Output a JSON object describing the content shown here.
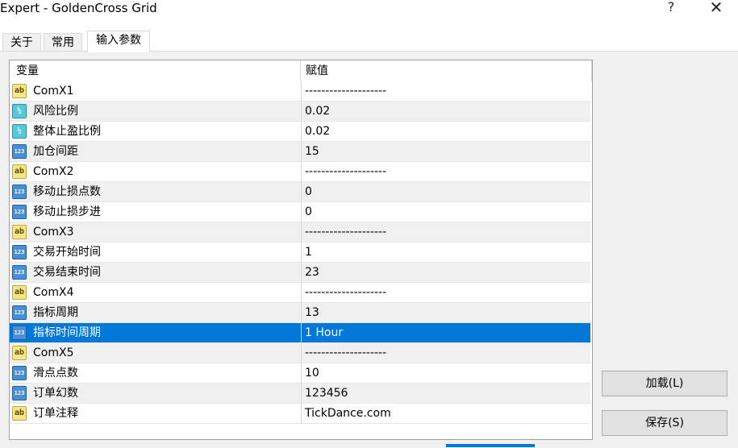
{
  "window": {
    "title": "Expert - GoldenCross Grid",
    "help_label": "?",
    "close_label": "✕"
  },
  "tabs": [
    {
      "label": "关于"
    },
    {
      "label": "常用"
    },
    {
      "label": "输入参数",
      "active": true
    }
  ],
  "grid": {
    "headers": {
      "name": "变量",
      "value": "赋值"
    },
    "rows": [
      {
        "icon": "string-icon",
        "name": "ComX1",
        "value": "--------------------"
      },
      {
        "icon": "double-icon",
        "name": "风险比例",
        "value": "0.02"
      },
      {
        "icon": "double-icon",
        "name": "整体止盈比例",
        "value": "0.02"
      },
      {
        "icon": "integer-icon",
        "name": "加仓间距",
        "value": "15"
      },
      {
        "icon": "string-icon",
        "name": "ComX2",
        "value": "--------------------"
      },
      {
        "icon": "integer-icon",
        "name": "移动止损点数",
        "value": "0"
      },
      {
        "icon": "integer-icon",
        "name": "移动止损步进",
        "value": "0"
      },
      {
        "icon": "string-icon",
        "name": "ComX3",
        "value": "--------------------"
      },
      {
        "icon": "integer-icon",
        "name": "交易开始时间",
        "value": "1"
      },
      {
        "icon": "integer-icon",
        "name": "交易结束时间",
        "value": "23"
      },
      {
        "icon": "string-icon",
        "name": "ComX4",
        "value": "--------------------"
      },
      {
        "icon": "integer-icon",
        "name": "指标周期",
        "value": "13"
      },
      {
        "icon": "integer-icon",
        "name": "指标时间周期",
        "value": "1 Hour",
        "selected": true
      },
      {
        "icon": "string-icon",
        "name": "ComX5",
        "value": "--------------------"
      },
      {
        "icon": "integer-icon",
        "name": "滑点点数",
        "value": "10"
      },
      {
        "icon": "integer-icon",
        "name": "订单幻数",
        "value": "123456"
      },
      {
        "icon": "string-icon",
        "name": "订单注释",
        "value": "TickDance.com"
      }
    ]
  },
  "icon_glyphs": {
    "string": "ab",
    "integer": "123",
    "double": "½"
  },
  "buttons": {
    "load": "加载(L)",
    "save": "保存(S)"
  },
  "colors": {
    "selection": "#0078d7",
    "alt_row": "#f0f0f0"
  }
}
